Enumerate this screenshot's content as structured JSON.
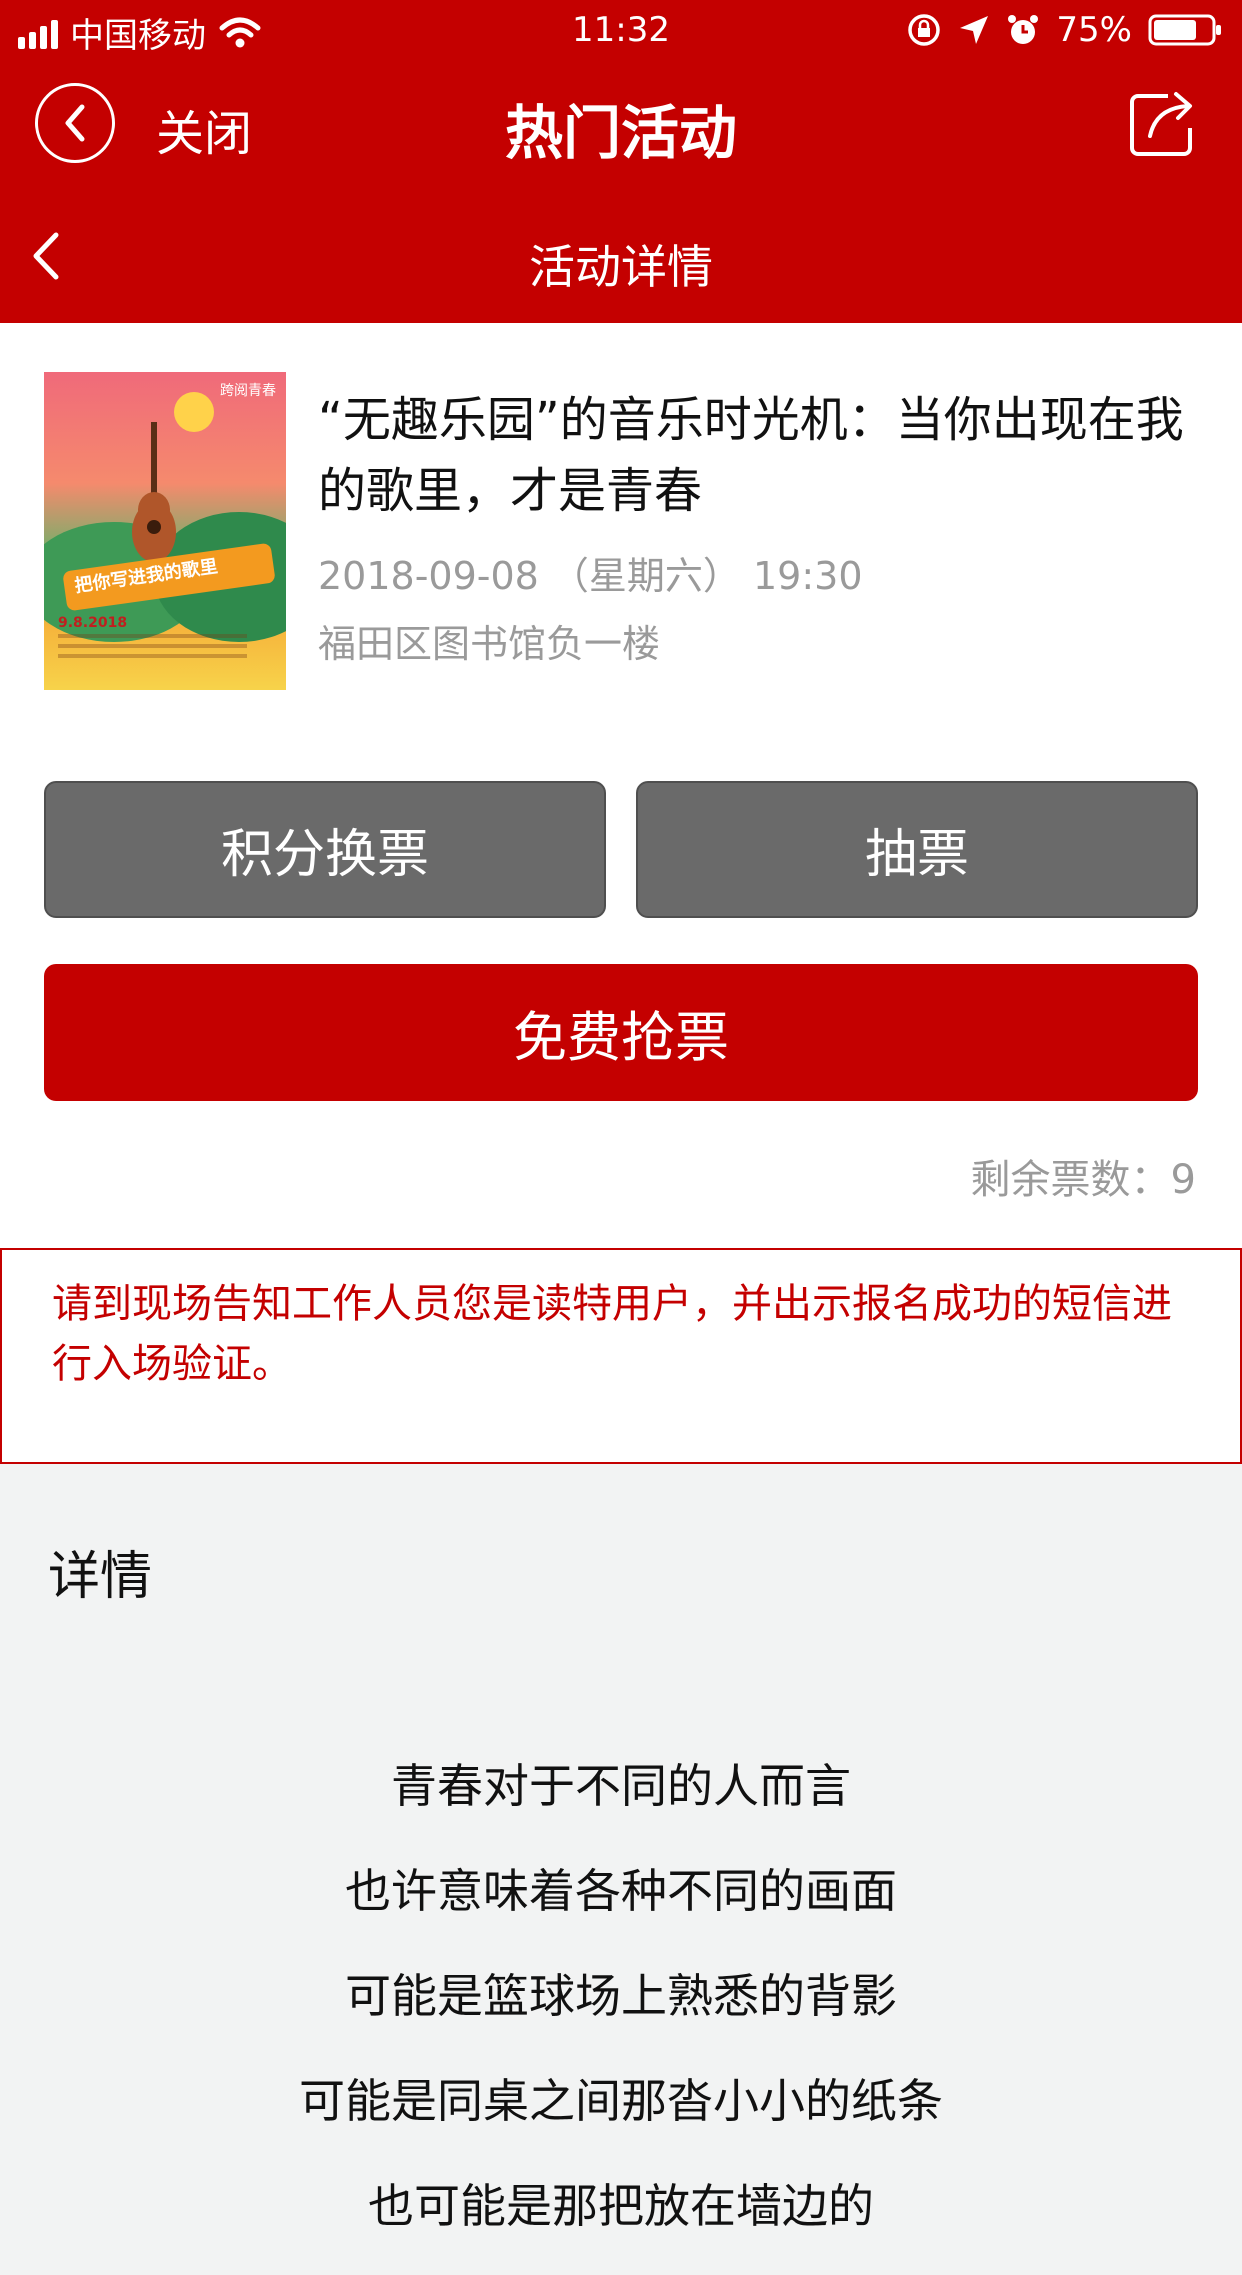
{
  "status_bar": {
    "carrier": "中国移动",
    "time": "11:32",
    "battery": "75%"
  },
  "nav": {
    "close_label": "关闭",
    "title": "热门活动"
  },
  "subnav": {
    "title": "活动详情"
  },
  "event": {
    "poster_tag": "跨阅青春",
    "poster_headline": "把你写进我的歌里",
    "poster_date": "9.8.2018",
    "title": "“无趣乐园”的音乐时光机：当你出现在我的歌里，才是青春",
    "datetime": "2018-09-08 （星期六） 19:30",
    "location": "福田区图书馆负一楼"
  },
  "buttons": {
    "points_exchange": "积分换票",
    "lottery": "抽票",
    "free_ticket": "免费抢票"
  },
  "remaining_tickets": "剩余票数：9",
  "notice": "请到现场告知工作人员您是读特用户，并出示报名成功的短信进行入场验证。",
  "details": {
    "heading": "详情",
    "poem_lines": [
      "青春对于不同的人而言",
      "也许意味着各种不同的画面",
      "可能是篮球场上熟悉的背影",
      "可能是同桌之间那沓小小的纸条",
      "也可能是那把放在墙边的"
    ]
  },
  "colors": {
    "brand_red": "#c40000",
    "button_gray": "#6a6a6a",
    "muted_text": "#9a9a9a",
    "page_bg": "#f2f3f3"
  },
  "icons": {
    "back": "chevron-left-icon",
    "share": "share-icon",
    "wifi": "wifi-icon",
    "signal": "signal-icon",
    "battery": "battery-icon",
    "alarm": "alarm-icon",
    "location": "location-arrow-icon",
    "rotation_lock": "rotation-lock-icon"
  }
}
